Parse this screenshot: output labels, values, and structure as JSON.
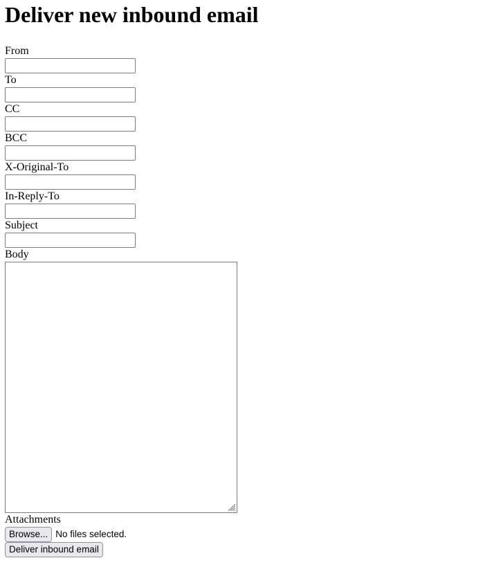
{
  "page": {
    "title": "Deliver new inbound email"
  },
  "form": {
    "fields": [
      {
        "label": "From",
        "value": ""
      },
      {
        "label": "To",
        "value": ""
      },
      {
        "label": "CC",
        "value": ""
      },
      {
        "label": "BCC",
        "value": ""
      },
      {
        "label": "X-Original-To",
        "value": ""
      },
      {
        "label": "In-Reply-To",
        "value": ""
      },
      {
        "label": "Subject",
        "value": ""
      }
    ],
    "body": {
      "label": "Body",
      "value": ""
    },
    "attachments": {
      "label": "Attachments",
      "browse_label": "Browse...",
      "status": "No files selected."
    },
    "submit_label": "Deliver inbound email"
  }
}
